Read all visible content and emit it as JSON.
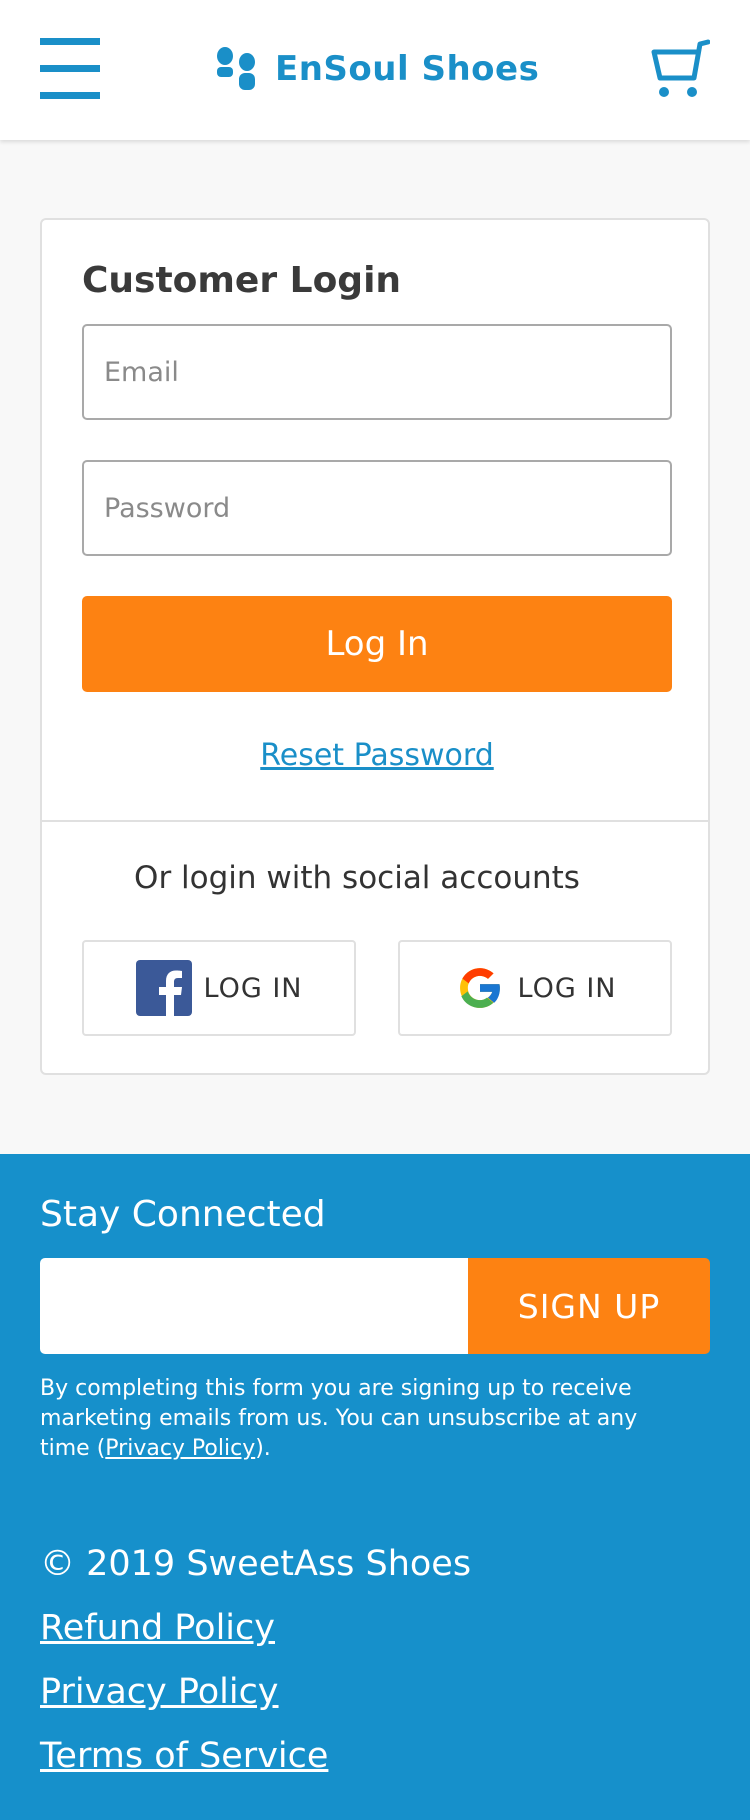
{
  "header": {
    "brand": "EnSoul Shoes",
    "menu_icon": "hamburger-menu-icon",
    "cart_icon": "shopping-cart-icon",
    "brand_color": "#1a8fc8"
  },
  "login": {
    "title": "Customer Login",
    "email_placeholder": "Email",
    "password_placeholder": "Password",
    "login_label": "Log In",
    "reset_label": "Reset Password",
    "social_text": "Or login with social accounts",
    "facebook_label": "LOG IN",
    "google_label": "LOG IN",
    "accent_color": "#fd8212"
  },
  "footer": {
    "stay_connected": "Stay Connected",
    "signup_label": "SIGN UP",
    "disclaimer_text": "By completing this form you are signing up to receive marketing emails from us. You can unsubscribe at any time (",
    "disclaimer_link": "Privacy Policy",
    "disclaimer_end": ").",
    "copyright": "© 2019 SweetAss Shoes",
    "links": [
      "Refund Policy",
      "Privacy Policy",
      "Terms of Service"
    ],
    "background_color": "#1690cb"
  }
}
